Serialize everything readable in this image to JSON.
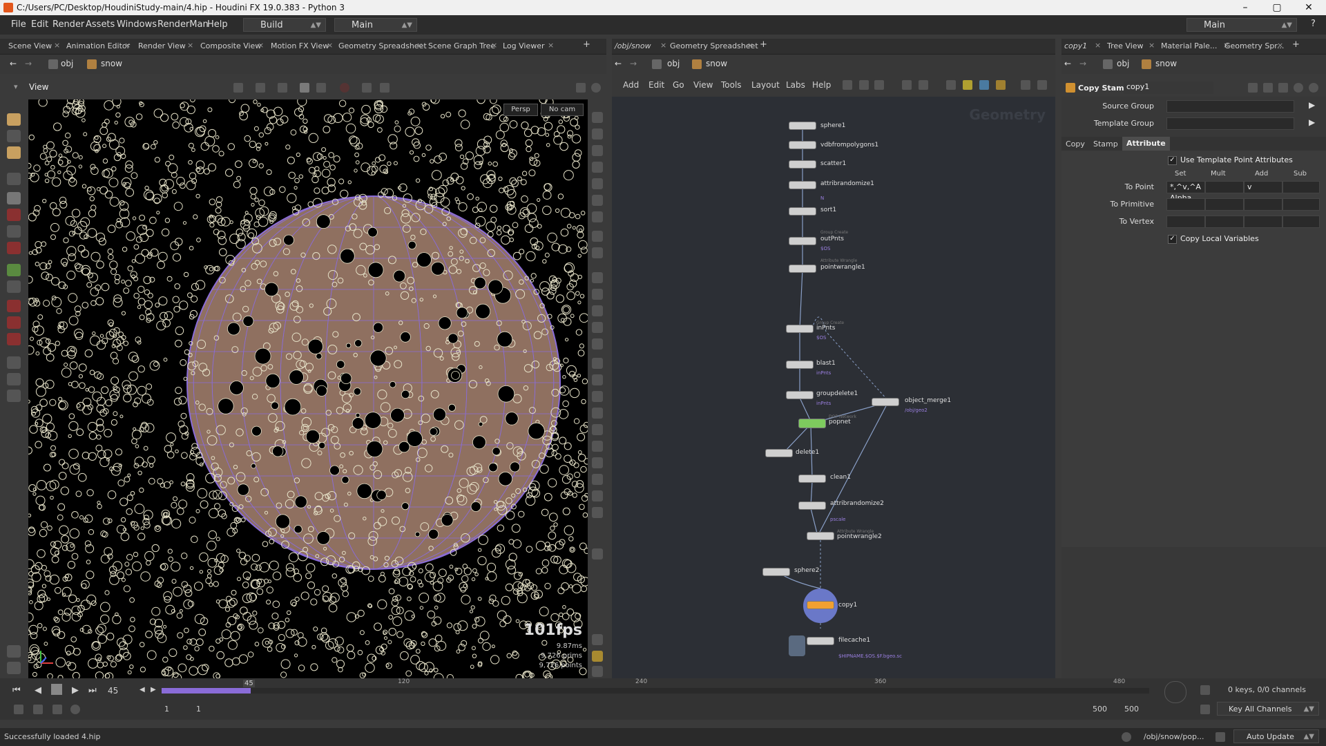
{
  "window": {
    "title": "C:/Users/PC/Desktop/HoudiniStudy-main/4.hip - Houdini FX 19.0.383 - Python 3",
    "minimize": "–",
    "maximize": "▢",
    "close": "✕"
  },
  "menubar": {
    "items": [
      "File",
      "Edit",
      "Render",
      "Assets",
      "Windows",
      "RenderMan",
      "Help"
    ],
    "desktop": "Build",
    "context": "Main",
    "right_context": "Main"
  },
  "left_pane": {
    "tabs": [
      "Scene View",
      "Animation Editor",
      "Render View",
      "Composite View",
      "Motion FX View",
      "Geometry Spreadsheet",
      "Scene Graph Tree",
      "Log Viewer"
    ],
    "path": [
      "obj",
      "snow"
    ],
    "view_label": "View",
    "persp": "Persp",
    "cam": "No cam",
    "fps": "101fps",
    "ms": "9.87ms",
    "prims": "9,726  prims",
    "points": "9,726  points"
  },
  "network_pane": {
    "tabs": [
      "/obj/snow",
      "Geometry Spreadsheet"
    ],
    "path": [
      "obj",
      "snow"
    ],
    "menu": [
      "Add",
      "Edit",
      "Go",
      "View",
      "Tools",
      "Layout",
      "Labs",
      "Help"
    ],
    "watermark": "Geometry",
    "nodes": {
      "sphere1": "sphere1",
      "vdbfrompolygons1": "vdbfrompolygons1",
      "scatter1": "scatter1",
      "attribrandomize1": "attribrandomize1",
      "attribrandomize1_sub": "N",
      "sort1": "sort1",
      "outPnts_type": "Group Create",
      "outPnts": "outPnts",
      "outPnts_sub": "$OS",
      "pointwrangle1_type": "Attribute Wrangle",
      "pointwrangle1": "pointwrangle1",
      "inPnts_type": "Group Create",
      "inPnts": "inPnts",
      "inPnts_sub": "$OS",
      "blast1": "blast1",
      "blast1_sub": "inPnts",
      "groupdelete1": "groupdelete1",
      "groupdelete1_sub": "inPnts",
      "object_merge1": "object_merge1",
      "object_merge1_sub": "/obj/geo2",
      "popnet_type": "DOP Network",
      "popnet": "popnet",
      "delete1": "delete1",
      "clean1": "clean1",
      "attribrandomize2": "attribrandomize2",
      "attribrandomize2_sub": "pscale",
      "pointwrangle2_type": "Attribute Wrangle",
      "pointwrangle2": "pointwrangle2",
      "sphere2": "sphere2",
      "copy1": "copy1",
      "filecache1": "filecache1",
      "filecache1_sub": "$HIPNAME.$OS.$F.bgeo.sc"
    }
  },
  "param_pane": {
    "tabs": [
      "copy1",
      "Tree View",
      "Material Pale...",
      "Geometry Spr..."
    ],
    "path": [
      "obj",
      "snow"
    ],
    "node_type": "Copy Stamp",
    "node_name": "copy1",
    "source_group_label": "Source Group",
    "template_group_label": "Template Group",
    "subtabs": [
      "Copy",
      "Stamp",
      "Attribute"
    ],
    "use_template_point_attributes": "Use Template Point Attributes",
    "cols": [
      "Set",
      "Mult",
      "Add",
      "Sub"
    ],
    "to_point_label": "To Point",
    "to_point_set": "*,^v,^A Alpha",
    "to_point_add": "v",
    "to_primitive_label": "To Primitive",
    "to_vertex_label": "To Vertex",
    "copy_local_variables": "Copy Local Variables"
  },
  "timeline": {
    "current_frame": "45",
    "ticks": [
      "120",
      "240",
      "360",
      "480"
    ],
    "start": "1",
    "start2": "1",
    "end": "500",
    "end2": "500",
    "keys_status": "0 keys, 0/0 channels",
    "key_all_channels": "Key All Channels",
    "progress": 0.09
  },
  "status": {
    "message": "Successfully loaded 4.hip",
    "path": "/obj/snow/pop...",
    "auto_update": "Auto Update"
  },
  "colors": {
    "accent_purple": "#8a6cd8",
    "sphere_fill": "#8f7060",
    "particle": "#e6e2c8",
    "popnet_green": "#7ecb5e",
    "copy_orange": "#f0a030"
  }
}
